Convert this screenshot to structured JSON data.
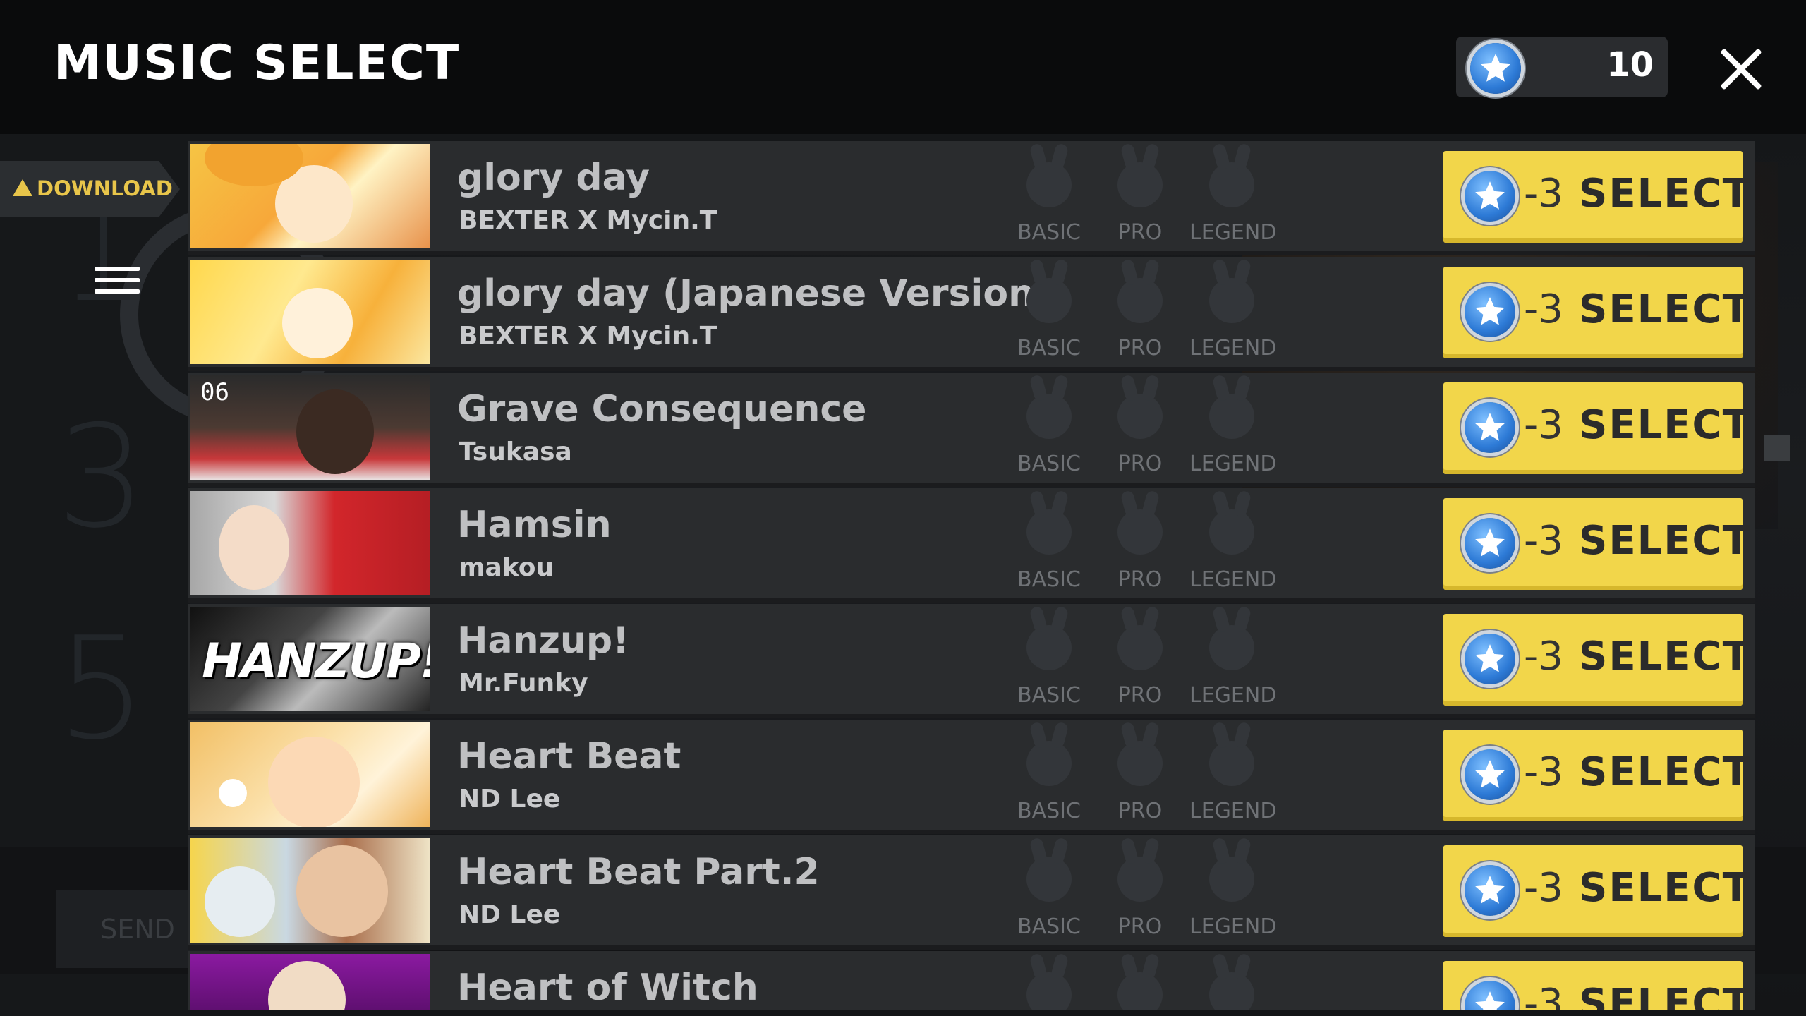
{
  "header": {
    "title": "MUSIC SELECT",
    "coins": "10"
  },
  "side": {
    "download_label": "DOWNLOAD"
  },
  "background": {
    "numbers": [
      "1",
      "3",
      "5"
    ],
    "send_label": "SEND"
  },
  "difficulty_labels": {
    "basic": "BASIC",
    "pro": "PRO",
    "legend": "LEGEND"
  },
  "select_button": {
    "cost": "-3",
    "label": "SELECT"
  },
  "songs": [
    {
      "title": "glory day",
      "artist": "BEXTER X Mycin.T"
    },
    {
      "title": "glory day (Japanese Version)",
      "artist": "BEXTER X Mycin.T"
    },
    {
      "title": "Grave Consequence",
      "artist": "Tsukasa",
      "thumb_text": "06"
    },
    {
      "title": "Hamsin",
      "artist": "makou"
    },
    {
      "title": "Hanzup!",
      "artist": "Mr.Funky",
      "thumb_text": "HANZUP!"
    },
    {
      "title": "Heart Beat",
      "artist": "ND Lee"
    },
    {
      "title": "Heart Beat Part.2",
      "artist": "ND Lee"
    },
    {
      "title": "Heart of Witch",
      "artist": ""
    }
  ],
  "colors": {
    "select_yellow": "#f2d64a",
    "download_yellow": "#e8c54a",
    "row_bg": "#2a2c2e",
    "coin_blue": "#2d7ad6"
  },
  "icons": {
    "coin": "star-coin-icon",
    "close": "close-icon",
    "menu": "hamburger-menu-icon",
    "warning": "warning-triangle-icon",
    "difficulty": "bunny-ghost-icon"
  }
}
